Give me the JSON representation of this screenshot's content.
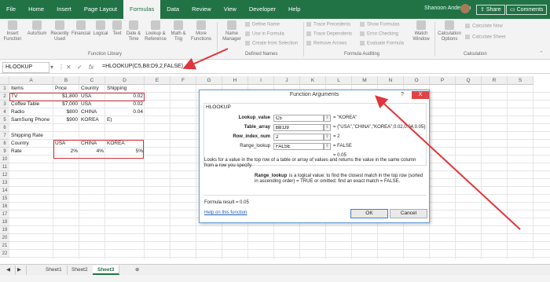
{
  "menubar": {
    "tabs": [
      "File",
      "Home",
      "Insert",
      "Page Layout",
      "Formulas",
      "Data",
      "Review",
      "View",
      "Developer",
      "Help"
    ],
    "active_index": 4,
    "user_name": "Shanoon Anderson",
    "share": "Share",
    "comments": "Comments"
  },
  "ribbon": {
    "insert_function": "Insert Function",
    "autosum": "AutoSum",
    "recently_used": "Recently Used",
    "financial": "Financial",
    "logical": "Logical",
    "text": "Text",
    "date_time": "Date & Time",
    "lookup_reference": "Lookup & Reference",
    "math_trig": "Math & Trig",
    "more_functions": "More Functions",
    "function_library_label": "Function Library",
    "name_manager": "Name Manager",
    "define_name": "Define Name",
    "use_in_formula": "Use in Formula",
    "create_from_selection": "Create from Selection",
    "defined_names_label": "Defined Names",
    "trace_precedents": "Trace Precedents",
    "trace_dependents": "Trace Dependents",
    "remove_arrows": "Remove Arrows",
    "show_formulas": "Show Formulas",
    "error_checking": "Error Checking",
    "evaluate_formula": "Evaluate Formula",
    "watch_window": "Watch Window",
    "formula_auditing_label": "Formula Auditing",
    "calculation_options": "Calculation Options",
    "calculate_now": "Calculate Now",
    "calculate_sheet": "Calculate Sheet",
    "calculation_label": "Calculation"
  },
  "formula_bar": {
    "name_box": "HLOOKUP",
    "formula": "=HLOOKUP(C5,B8:D9,2,FALSE)"
  },
  "grid": {
    "columns": [
      "A",
      "B",
      "C",
      "D",
      "E",
      "F",
      "G",
      "H",
      "I",
      "J",
      "K",
      "L",
      "M",
      "N",
      "O",
      "P",
      "Q",
      "R",
      "S"
    ],
    "rows": [
      "1",
      "2",
      "3",
      "4",
      "5",
      "6",
      "7",
      "8",
      "9",
      "10",
      "11",
      "12",
      "13",
      "14",
      "15",
      "16",
      "17",
      "18",
      "19",
      "20",
      "21",
      "22"
    ],
    "cells": {
      "A1": "Items",
      "B1": "Price",
      "C1": "Country",
      "D1": "Shipping",
      "A2": "TV",
      "B2": "$1,800",
      "C2": "USA",
      "D2": "0.02",
      "A3": "Coffee Table",
      "B3": "$7,000",
      "C3": "USA",
      "D3": "0.02",
      "A4": "Radio",
      "B4": "$800",
      "C4": "CHINA",
      "D4": "0.04",
      "A5": "SamSung Phone",
      "B5": "$900",
      "C5": "KOREA",
      "D5": "E)",
      "A7": "Shipping Rate",
      "A8": "Country",
      "B8": "USA",
      "C8": "CHINA",
      "D8": "KOREA",
      "A9": "Rate",
      "B9": "2%",
      "C9": "4%",
      "D9": "5%"
    }
  },
  "sheets": [
    "Sheet1",
    "Sheet2",
    "Sheet3"
  ],
  "active_sheet": "Sheet3",
  "dialog": {
    "title": "Function Arguments",
    "help": "?",
    "close": "X",
    "function_name": "HLOOKUP",
    "args": [
      {
        "label": "Lookup_value",
        "bold": true,
        "input": "C5",
        "value": "= \"KOREA\""
      },
      {
        "label": "Table_array",
        "bold": true,
        "input": "B8:D9",
        "value": "= {\"USA\",\"CHINA\",\"KOREA\";0.02,0.04,0.05}"
      },
      {
        "label": "Row_index_num",
        "bold": true,
        "input": "2",
        "value": "= 2"
      },
      {
        "label": "Range_lookup",
        "bold": false,
        "input": "FALSE",
        "value": "= FALSE"
      }
    ],
    "result": "= 0.05",
    "description": "Looks for a value in the top row of a table or array of values and returns the value in the same column from a row you specify.",
    "arg_help_label": "Range_lookup",
    "arg_help": "is a logical value: to find the closest match in the top row (sorted in ascending order) = TRUE or omitted; find an exact match = FALSE.",
    "formula_result": "Formula result =  0.05",
    "help_link": "Help on this function",
    "ok": "OK",
    "cancel": "Cancel"
  }
}
